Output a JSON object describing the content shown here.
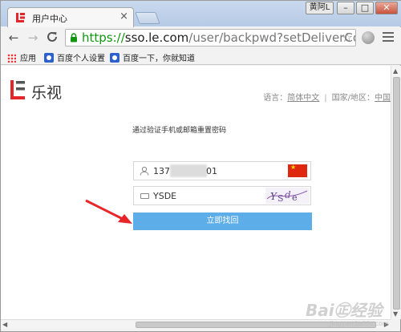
{
  "browser": {
    "tab_title": "用户中心",
    "tab_close": "×",
    "user_chip": "黄阿L",
    "window_buttons": {
      "minimize": "–",
      "maximize": "□",
      "close": "✕"
    },
    "nav": {
      "back": "←",
      "forward": "→",
      "reload": "C"
    },
    "url": {
      "scheme": "https://",
      "host": "sso.le.com",
      "path": "/user/backpwd?setDeliverCookie=ht"
    },
    "star": "☆"
  },
  "bookmarks": [
    {
      "label": "应用",
      "icon": "apps-grid-icon"
    },
    {
      "label": "百度个人设置",
      "icon": "baidu-paw-icon"
    },
    {
      "label": "百度一下，你就知道",
      "icon": "baidu-paw-icon"
    }
  ],
  "page": {
    "logo_text": "乐视",
    "language_label": "语言：",
    "language_value": "简体中文",
    "region_label": "国家/地区：",
    "region_value": "中国",
    "form_title": "通过验证手机或邮箱重置密码",
    "phone_prefix": "137",
    "phone_suffix": "01",
    "captcha_value": "YSDE",
    "submit_label": "立即找回"
  },
  "colors": {
    "accent_button": "#5daee8",
    "https_green": "#119611",
    "logo_red": "#e3262a"
  },
  "watermark": {
    "text": "Bai㊣经验",
    "sub": "jingyan.baidu.com"
  }
}
